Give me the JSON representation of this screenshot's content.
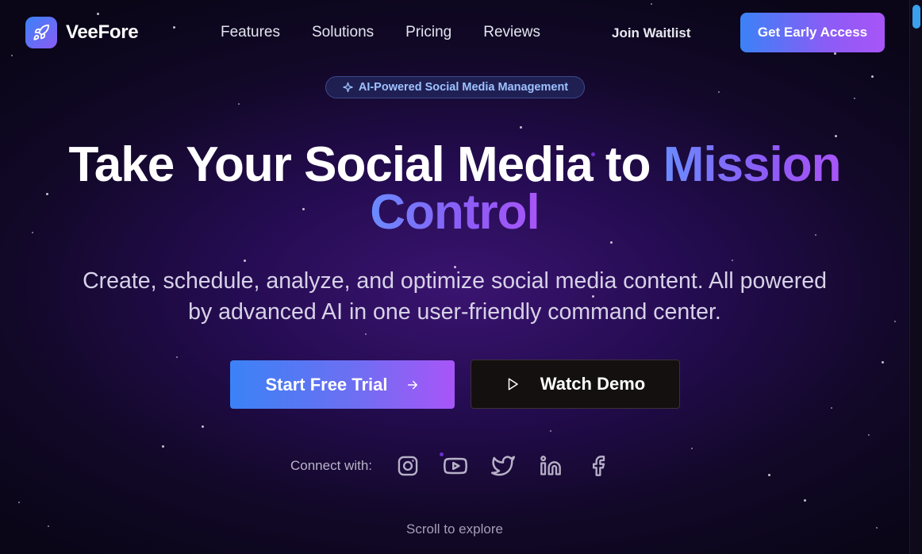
{
  "nav": {
    "brand": "VeeFore",
    "links": [
      "Features",
      "Solutions",
      "Pricing",
      "Reviews"
    ],
    "waitlist": "Join Waitlist",
    "cta": "Get Early Access"
  },
  "badge": "AI-Powered Social Media Management",
  "hero": {
    "headline_white": "Take Your Social Media to",
    "headline_gradient_1": "Mission",
    "headline_gradient_2": "Control",
    "subtitle": "Create, schedule, analyze, and optimize social media content. All powered by advanced AI in one user-friendly command center.",
    "primary_button": "Start Free Trial",
    "secondary_button": "Watch Demo"
  },
  "connect": {
    "label": "Connect with:",
    "icons": [
      "instagram-icon",
      "youtube-icon",
      "twitter-icon",
      "linkedin-icon",
      "facebook-icon"
    ]
  },
  "scroll_hint": "Scroll to explore",
  "colors": {
    "accent_blue": "#3b82f6",
    "accent_purple": "#a855f7",
    "background_dark": "#0a0618"
  }
}
